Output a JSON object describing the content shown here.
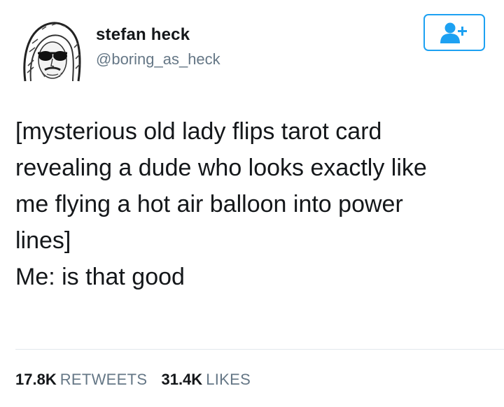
{
  "user": {
    "display_name": "stefan heck",
    "handle": "@boring_as_heck",
    "avatar_icon": "hooded-man-sunglasses-sketch-avatar"
  },
  "follow_button": {
    "icon": "add-user-icon",
    "color": "#1da1f2"
  },
  "tweet": {
    "lines": [
      "[mysterious old lady flips tarot card",
      "revealing a dude who looks exactly like",
      "me flying a hot air balloon into power",
      "lines]",
      "Me: is that good"
    ]
  },
  "stats": {
    "retweets_count": "17.8K",
    "retweets_label": "RETWEETS",
    "likes_count": "31.4K",
    "likes_label": "LIKES"
  },
  "colors": {
    "accent": "#1da1f2",
    "secondary_text": "#657786",
    "divider": "#e1e8ed"
  }
}
